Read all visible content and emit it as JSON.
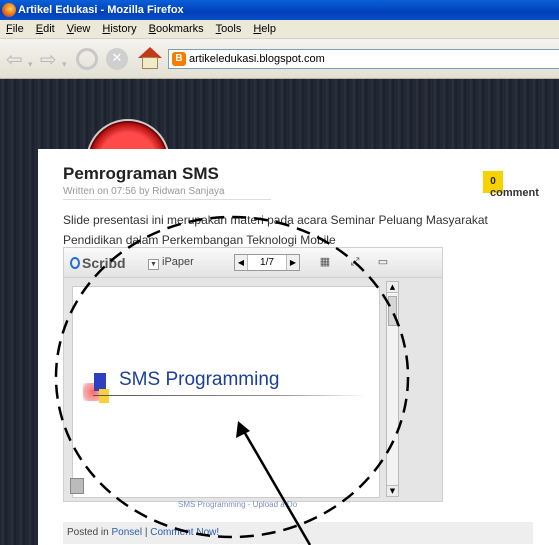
{
  "window": {
    "title": "Artikel Edukasi - Mozilla Firefox"
  },
  "menubar": {
    "items": [
      "File",
      "Edit",
      "View",
      "History",
      "Bookmarks",
      "Tools",
      "Help"
    ]
  },
  "toolbar": {
    "url": "artikeledukasi.blogspot.com",
    "icons": [
      "back-arrow-icon",
      "forward-arrow-icon",
      "reload-icon",
      "stop-icon",
      "home-icon",
      "blogger-icon"
    ]
  },
  "post": {
    "title": "Pemrograman SMS",
    "meta": "Written on 07:56 by Ridwan Sanjaya",
    "comment_count": "0",
    "comment_label": "comment",
    "body": "Slide presentasi ini merupakan materi pada acara Seminar Peluang Masyarakat Pendidikan dalam Perkembangan Teknologi Mobile",
    "footer_prefix": "Posted in",
    "footer_category": "Ponsel",
    "footer_separator": "|",
    "footer_comment": "Comment Now!"
  },
  "scribd": {
    "logo": "Scribd",
    "mode": "iPaper",
    "page_indicator": "1/7",
    "slide_title": "SMS Programming",
    "caption": "SMS Programming - Upload a Do"
  },
  "colors": {
    "titlebar": "#0a4fc8",
    "comment_badge": "#f6d300",
    "slide_title": "#1b3f9a",
    "link": "#2a5db0"
  }
}
